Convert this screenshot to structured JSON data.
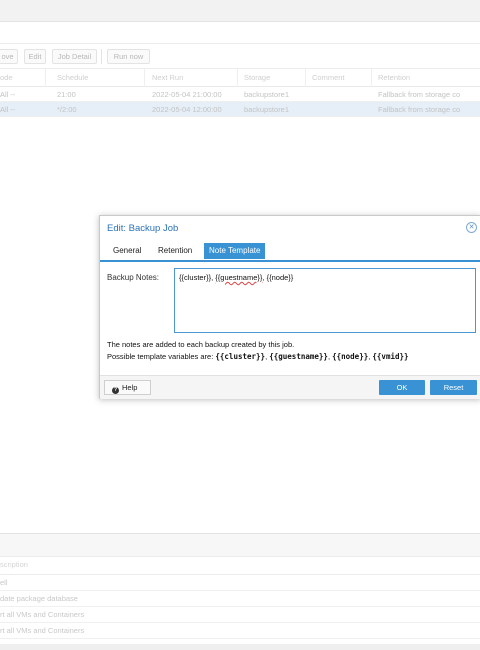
{
  "toolbar": {
    "remove_label": "ove",
    "edit_label": "Edit",
    "job_detail_label": "Job Detail",
    "run_now_label": "Run now"
  },
  "jobs_grid": {
    "columns": [
      "ode",
      "Schedule",
      "Next Run",
      "Storage",
      "Comment",
      "Retention"
    ],
    "rows": [
      {
        "node": "All --",
        "schedule": "21:00",
        "next_run": "2022-05-04 21:00:00",
        "storage": "backupstore1",
        "comment": "",
        "retention": "Fallback from storage co"
      },
      {
        "node": "All --",
        "schedule": "*/2:00",
        "next_run": "2022-05-04 12:00:00",
        "storage": "backupstore1",
        "comment": "",
        "retention": "Fallback from storage co"
      }
    ]
  },
  "lower_grid": {
    "header": "scription",
    "rows": [
      "ell",
      "date package database",
      "rt all VMs and Containers",
      "rt all VMs and Containers"
    ]
  },
  "dialog": {
    "title": "Edit: Backup Job",
    "tabs": [
      {
        "label": "General",
        "active": false
      },
      {
        "label": "Retention",
        "active": false
      },
      {
        "label": "Note Template",
        "active": true
      }
    ],
    "notes_label": "Backup Notes:",
    "notes_value_parts": [
      "{{cluster}}, ",
      "{{guestname}}",
      ", {{node}}"
    ],
    "info_line1": "The notes are added to each backup created by this job.",
    "info_line2_prefix": "Possible template variables are: ",
    "template_vars": [
      "{{cluster}}",
      "{{guestname}}",
      "{{node}}",
      "{{vmid}}"
    ],
    "help_label": "Help",
    "ok_label": "OK",
    "reset_label": "Reset"
  },
  "colors": {
    "accent": "#3892d4",
    "title": "#2a73b8",
    "selected_row": "#e6eff8"
  }
}
